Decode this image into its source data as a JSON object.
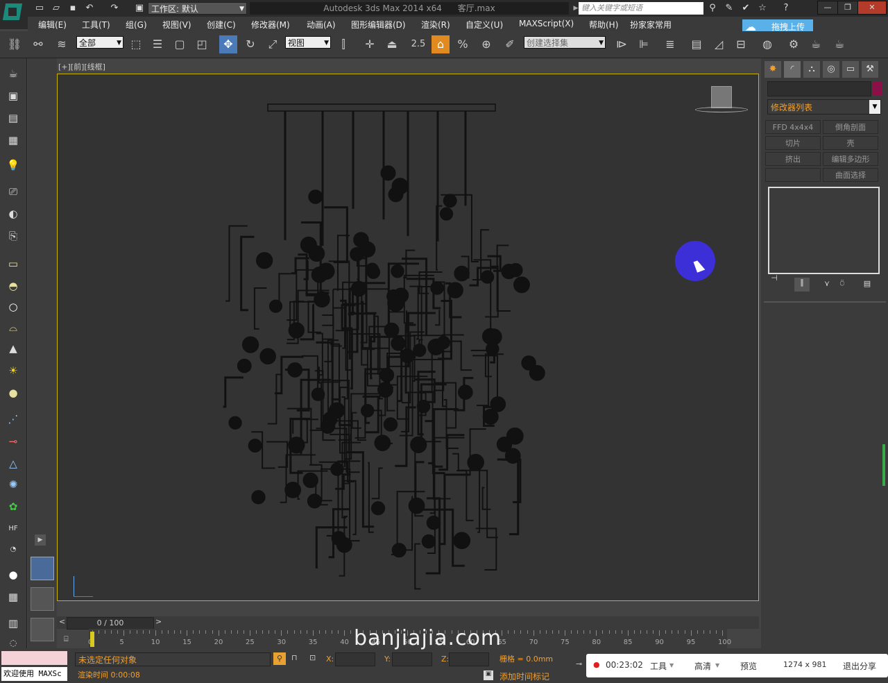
{
  "title_bar": {
    "workspace": "工作区: 默认",
    "app_title": "Autodesk 3ds Max  2014 x64",
    "file_name": "客厅.max",
    "search_placeholder": "键入关键字或短语"
  },
  "menu": [
    "编辑(E)",
    "工具(T)",
    "组(G)",
    "视图(V)",
    "创建(C)",
    "修改器(M)",
    "动画(A)",
    "图形编辑器(D)",
    "渲染(R)",
    "自定义(U)",
    "MAXScript(X)",
    "帮助(H)",
    "扮家家常用"
  ],
  "upload_button": "拖拽上传",
  "toolbar": {
    "selection_filter": "全部",
    "ref_coord": "视图",
    "snap_value": "2.5",
    "named_selection": "创建选择集"
  },
  "viewport": {
    "label": "[+][前][线框]"
  },
  "command_panel": {
    "modifier_list": "修改器列表",
    "modifiers": [
      "FFD 4x4x4",
      "倒角剖面",
      "切片",
      "壳",
      "挤出",
      "编辑多边形",
      "",
      "曲面选择"
    ]
  },
  "timeline": {
    "frame": "0 / 100",
    "ticks": [
      "0",
      "5",
      "10",
      "15",
      "20",
      "25",
      "30",
      "35",
      "40",
      "45",
      "50",
      "55",
      "60",
      "65",
      "70",
      "75",
      "80",
      "85",
      "90",
      "95",
      "100"
    ]
  },
  "status": {
    "message": "未选定任何对象",
    "render_time": "渲染时间  0:00:08",
    "welcome": "欢迎使用 MAXSc",
    "x_label": "X:",
    "y_label": "Y:",
    "z_label": "Z:",
    "grid": "栅格 = 0.0mm",
    "add_tag": "添加时间标记"
  },
  "recorder": {
    "time": "00:23:02",
    "tools": "工具",
    "quality": "高清",
    "preview": "预览",
    "resolution": "1274 x 981",
    "exit": "退出分享"
  },
  "watermark": "banjiajia.com",
  "colors": {
    "viewport_border": "#c8b400",
    "status_text": "#f0a030",
    "cursor_halo": "#3c2fd8"
  }
}
